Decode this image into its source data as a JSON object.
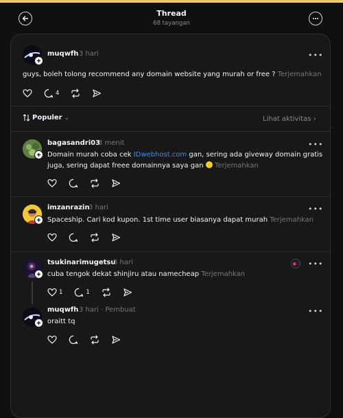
{
  "header": {
    "title": "Thread",
    "subtitle": "68 tayangan"
  },
  "root_post": {
    "username": "muqwfh",
    "time": "3 hari",
    "text": "guys, boleh tolong recommend any domain website yang murah or free ?",
    "translate": "Terjemahkan",
    "reply_count": "4"
  },
  "sort": {
    "label": "Populer",
    "activity": "Lihat aktivitas"
  },
  "replies": [
    {
      "username": "bagasandri03",
      "time": "3 menit",
      "text_before": "Domain murah coba cek ",
      "link": "IDwebhost.com",
      "text_after_line1": " gan, sering ada giveway domain gratis",
      "text_line2": "juga, sering dapat freee domainnya saya gan",
      "translate": "Terjemahkan"
    },
    {
      "username": "imzanrazin",
      "time": "3 hari",
      "text": "Spaceship. Cari kod kupon. 1st time user biasanya dapat murah",
      "translate": "Terjemahkan"
    },
    {
      "username": "tsukinarimugetsu",
      "time": "3 hari",
      "text": "cuba tengok dekat shinjiru atau namecheap",
      "translate": "Terjemahkan",
      "like_count": "1",
      "reply_count": "1"
    },
    {
      "username": "muqwfh",
      "time": "3 hari",
      "creator": "Pembuat",
      "text": "oraitt tq"
    }
  ],
  "colors": {
    "background": "#101010",
    "card": "#181818",
    "link": "#3b8df0",
    "muted": "#777777"
  },
  "icons": [
    "back-arrow-icon",
    "more-circle-icon",
    "heart-icon",
    "comment-icon",
    "repost-icon",
    "share-icon",
    "sort-icon"
  ]
}
